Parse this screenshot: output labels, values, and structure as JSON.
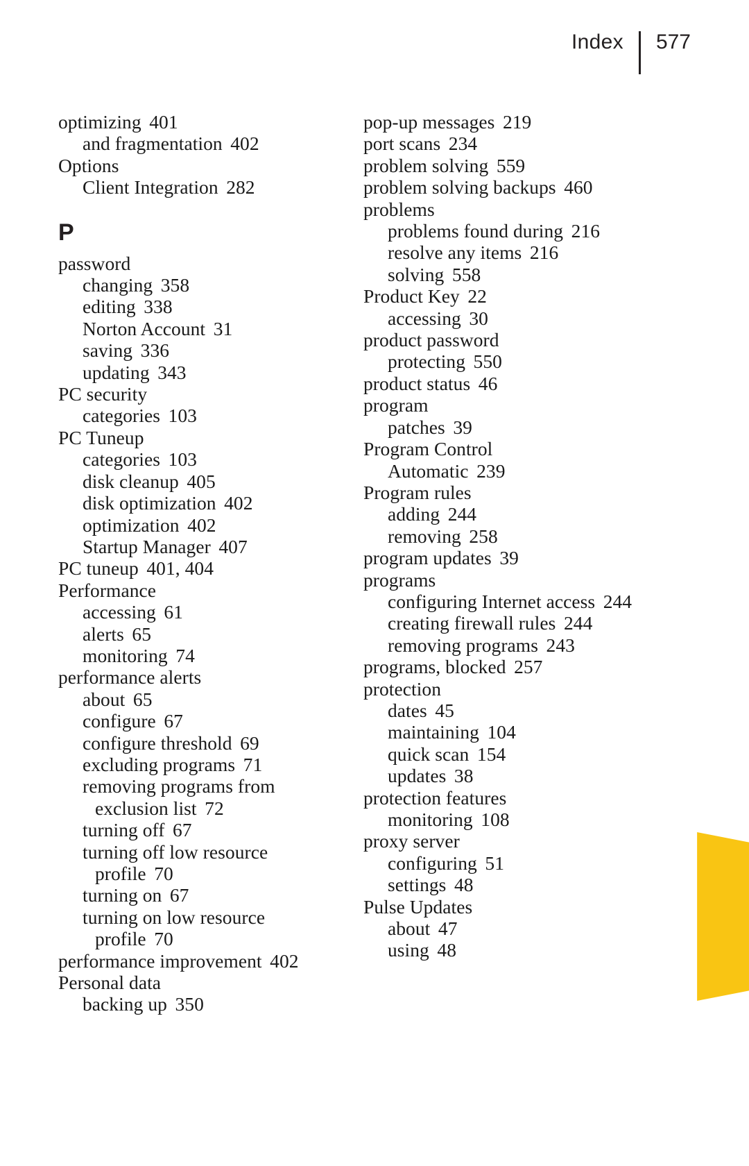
{
  "page": {
    "running_head_label": "Index",
    "folio": "577",
    "background_color": "#ffffff",
    "text_color": "#1a1a1a",
    "accent_color": "#f9c513"
  },
  "columns": [
    {
      "name": "left-column",
      "blocks": [
        {
          "type": "entries",
          "entries": [
            {
              "level": 0,
              "text": "optimizing",
              "locator": "401"
            },
            {
              "level": 1,
              "text": "and fragmentation",
              "locator": "402"
            },
            {
              "level": 0,
              "text": "Options",
              "locator": ""
            },
            {
              "level": 1,
              "text": "Client Integration",
              "locator": "282"
            }
          ]
        },
        {
          "type": "section-letter",
          "letter": "P"
        },
        {
          "type": "entries",
          "entries": [
            {
              "level": 0,
              "text": "password",
              "locator": ""
            },
            {
              "level": 1,
              "text": "changing",
              "locator": "358"
            },
            {
              "level": 1,
              "text": "editing",
              "locator": "338"
            },
            {
              "level": 1,
              "text": "Norton Account",
              "locator": "31"
            },
            {
              "level": 1,
              "text": "saving",
              "locator": "336"
            },
            {
              "level": 1,
              "text": "updating",
              "locator": "343"
            },
            {
              "level": 0,
              "text": "PC security",
              "locator": ""
            },
            {
              "level": 1,
              "text": "categories",
              "locator": "103"
            },
            {
              "level": 0,
              "text": "PC Tuneup",
              "locator": ""
            },
            {
              "level": 1,
              "text": "categories",
              "locator": "103"
            },
            {
              "level": 1,
              "text": "disk cleanup",
              "locator": "405"
            },
            {
              "level": 1,
              "text": "disk optimization",
              "locator": "402"
            },
            {
              "level": 1,
              "text": "optimization",
              "locator": "402"
            },
            {
              "level": 1,
              "text": "Startup Manager",
              "locator": "407"
            },
            {
              "level": 0,
              "text": "PC tuneup",
              "locator": "401, 404"
            },
            {
              "level": 0,
              "text": "Performance",
              "locator": ""
            },
            {
              "level": 1,
              "text": "accessing",
              "locator": "61"
            },
            {
              "level": 1,
              "text": "alerts",
              "locator": "65"
            },
            {
              "level": 1,
              "text": "monitoring",
              "locator": "74"
            },
            {
              "level": 0,
              "text": "performance alerts",
              "locator": ""
            },
            {
              "level": 1,
              "text": "about",
              "locator": "65"
            },
            {
              "level": 1,
              "text": "configure",
              "locator": "67"
            },
            {
              "level": 1,
              "text": "configure threshold",
              "locator": "69"
            },
            {
              "level": 1,
              "text": "excluding programs",
              "locator": "71"
            },
            {
              "level": 1,
              "text": "removing programs from",
              "locator": ""
            },
            {
              "level": 2,
              "text": "exclusion list",
              "locator": "72"
            },
            {
              "level": 1,
              "text": "turning off",
              "locator": "67"
            },
            {
              "level": 1,
              "text": "turning off low resource",
              "locator": ""
            },
            {
              "level": 2,
              "text": "profile",
              "locator": "70"
            },
            {
              "level": 1,
              "text": "turning on",
              "locator": "67"
            },
            {
              "level": 1,
              "text": "turning on low resource",
              "locator": ""
            },
            {
              "level": 2,
              "text": "profile",
              "locator": "70"
            },
            {
              "level": 0,
              "text": "performance improvement",
              "locator": "402"
            },
            {
              "level": 0,
              "text": "Personal data",
              "locator": ""
            },
            {
              "level": 1,
              "text": "backing up",
              "locator": "350"
            }
          ]
        }
      ]
    },
    {
      "name": "right-column",
      "blocks": [
        {
          "type": "entries",
          "entries": [
            {
              "level": 0,
              "text": "pop-up messages",
              "locator": "219"
            },
            {
              "level": 0,
              "text": "port scans",
              "locator": "234"
            },
            {
              "level": 0,
              "text": "problem solving",
              "locator": "559"
            },
            {
              "level": 0,
              "text": "problem solving backups",
              "locator": "460"
            },
            {
              "level": 0,
              "text": "problems",
              "locator": ""
            },
            {
              "level": 1,
              "text": "problems found during",
              "locator": "216"
            },
            {
              "level": 1,
              "text": "resolve any items",
              "locator": "216"
            },
            {
              "level": 1,
              "text": "solving",
              "locator": "558"
            },
            {
              "level": 0,
              "text": "Product Key",
              "locator": "22"
            },
            {
              "level": 1,
              "text": "accessing",
              "locator": "30"
            },
            {
              "level": 0,
              "text": "product password",
              "locator": ""
            },
            {
              "level": 1,
              "text": "protecting",
              "locator": "550"
            },
            {
              "level": 0,
              "text": "product status",
              "locator": "46"
            },
            {
              "level": 0,
              "text": "program",
              "locator": ""
            },
            {
              "level": 1,
              "text": "patches",
              "locator": "39"
            },
            {
              "level": 0,
              "text": "Program Control",
              "locator": ""
            },
            {
              "level": 1,
              "text": "Automatic",
              "locator": "239"
            },
            {
              "level": 0,
              "text": "Program rules",
              "locator": ""
            },
            {
              "level": 1,
              "text": "adding",
              "locator": "244"
            },
            {
              "level": 1,
              "text": "removing",
              "locator": "258"
            },
            {
              "level": 0,
              "text": "program updates",
              "locator": "39"
            },
            {
              "level": 0,
              "text": "programs",
              "locator": ""
            },
            {
              "level": 1,
              "text": "configuring Internet access",
              "locator": "244"
            },
            {
              "level": 1,
              "text": "creating firewall rules",
              "locator": "244"
            },
            {
              "level": 1,
              "text": "removing programs",
              "locator": "243"
            },
            {
              "level": 0,
              "text": "programs, blocked",
              "locator": "257"
            },
            {
              "level": 0,
              "text": "protection",
              "locator": ""
            },
            {
              "level": 1,
              "text": "dates",
              "locator": "45"
            },
            {
              "level": 1,
              "text": "maintaining",
              "locator": "104"
            },
            {
              "level": 1,
              "text": "quick scan",
              "locator": "154"
            },
            {
              "level": 1,
              "text": "updates",
              "locator": "38"
            },
            {
              "level": 0,
              "text": "protection features",
              "locator": ""
            },
            {
              "level": 1,
              "text": "monitoring",
              "locator": "108"
            },
            {
              "level": 0,
              "text": "proxy server",
              "locator": ""
            },
            {
              "level": 1,
              "text": "configuring",
              "locator": "51"
            },
            {
              "level": 1,
              "text": "settings",
              "locator": "48"
            },
            {
              "level": 0,
              "text": "Pulse Updates",
              "locator": ""
            },
            {
              "level": 1,
              "text": "about",
              "locator": "47"
            },
            {
              "level": 1,
              "text": "using",
              "locator": "48"
            }
          ]
        }
      ]
    }
  ]
}
